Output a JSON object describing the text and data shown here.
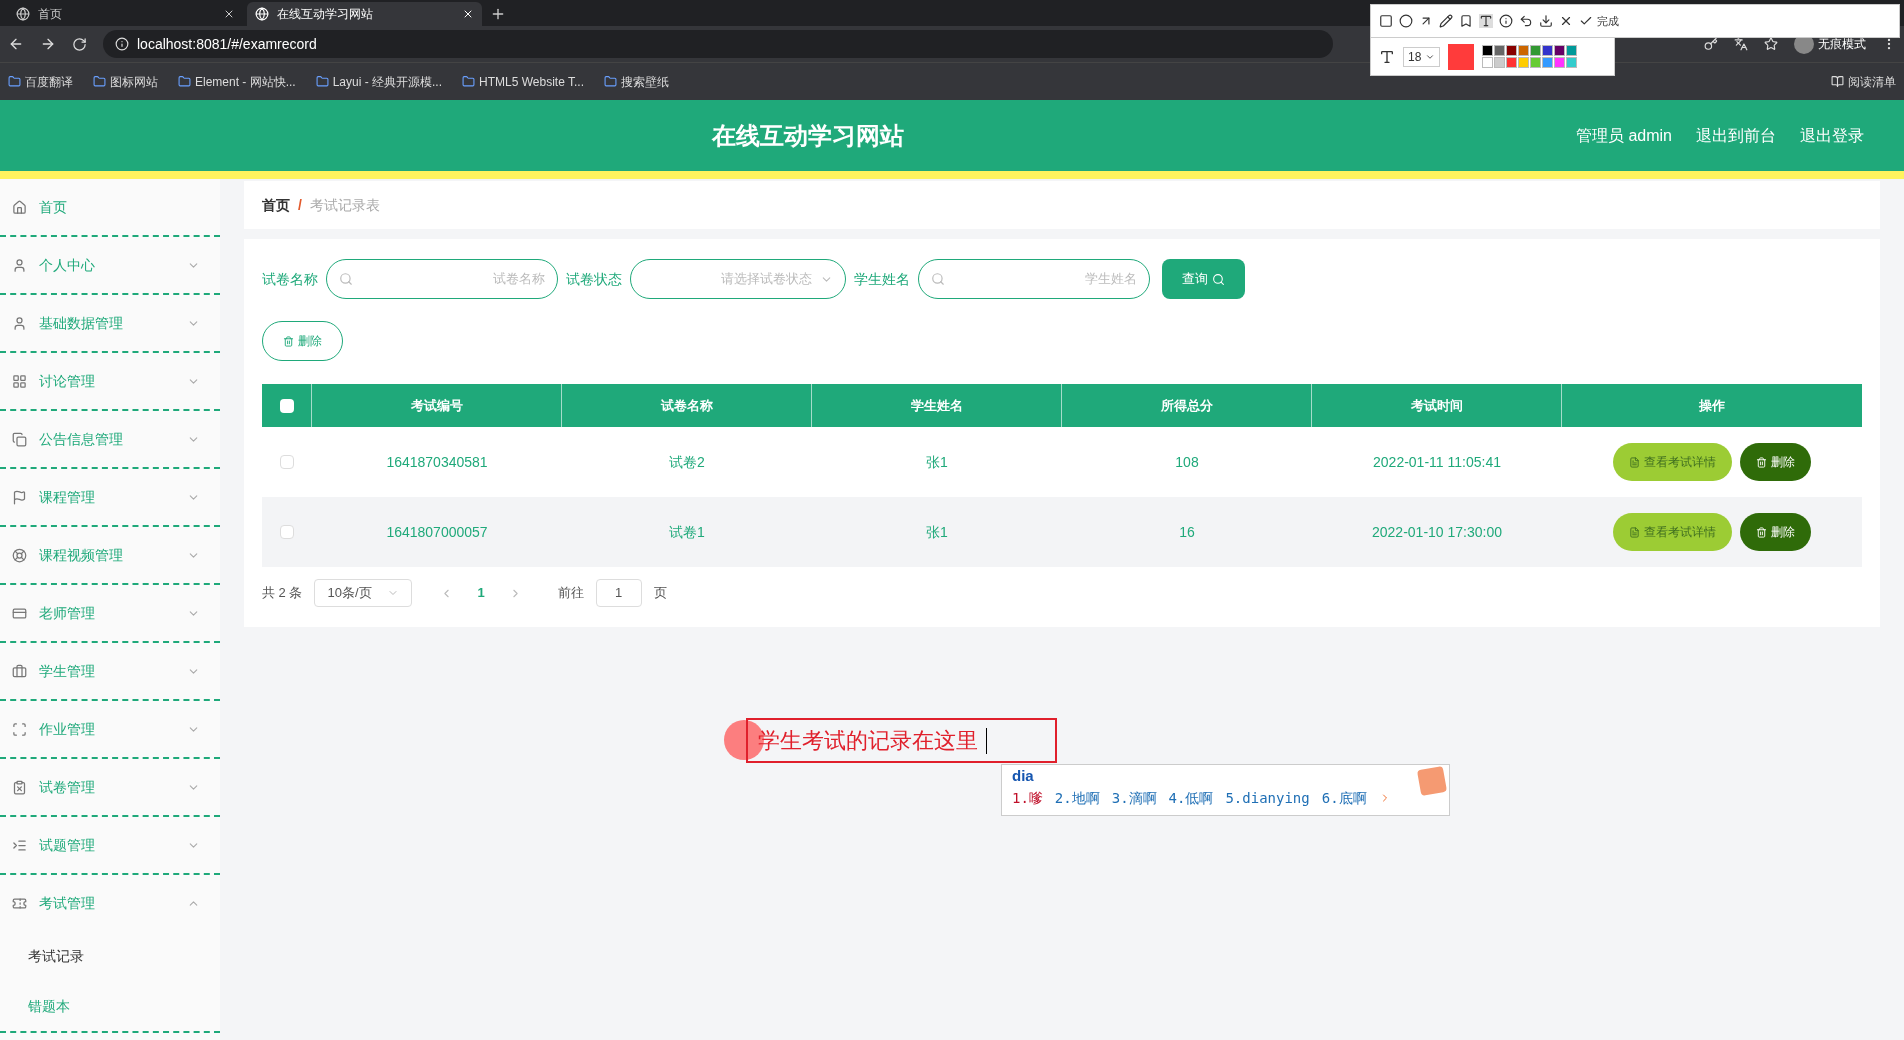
{
  "browser": {
    "tabs": [
      {
        "title": "首页",
        "selected": false
      },
      {
        "title": "在线互动学习网站",
        "selected": true
      }
    ],
    "url": "localhost:8081/#/examrecord",
    "profile": "无痕模式",
    "bookmarks": [
      "百度翻译",
      "图标网站",
      "Element - 网站快...",
      "Layui - 经典开源模...",
      "HTML5 Website T...",
      "搜索壁纸"
    ],
    "reading_list": "阅读清单"
  },
  "annotation_toolbar": {
    "font_size": "18",
    "done": "完成"
  },
  "header": {
    "title": "在线互动学习网站",
    "links": [
      "管理员 admin",
      "退出到前台",
      "退出登录"
    ]
  },
  "sidebar": [
    {
      "label": "首页",
      "kind": "link"
    },
    {
      "label": "个人中心",
      "kind": "group",
      "expanded": false
    },
    {
      "label": "基础数据管理",
      "kind": "group",
      "expanded": false
    },
    {
      "label": "讨论管理",
      "kind": "group",
      "expanded": false
    },
    {
      "label": "公告信息管理",
      "kind": "group",
      "expanded": false
    },
    {
      "label": "课程管理",
      "kind": "group",
      "expanded": false
    },
    {
      "label": "课程视频管理",
      "kind": "group",
      "expanded": false
    },
    {
      "label": "老师管理",
      "kind": "group",
      "expanded": false
    },
    {
      "label": "学生管理",
      "kind": "group",
      "expanded": false
    },
    {
      "label": "作业管理",
      "kind": "group",
      "expanded": false
    },
    {
      "label": "试卷管理",
      "kind": "group",
      "expanded": false
    },
    {
      "label": "试题管理",
      "kind": "group",
      "expanded": false
    },
    {
      "label": "考试管理",
      "kind": "group",
      "expanded": true,
      "children": [
        {
          "label": "考试记录",
          "selected": true
        },
        {
          "label": "错题本",
          "selected": false
        }
      ]
    }
  ],
  "breadcrumb": [
    "首页",
    "/",
    "考试记录表"
  ],
  "filters": [
    {
      "label": "试卷名称",
      "placeholder": "试卷名称",
      "kind": "search"
    },
    {
      "label": "试卷状态",
      "placeholder": "请选择试卷状态",
      "kind": "select"
    },
    {
      "label": "学生姓名",
      "placeholder": "学生姓名",
      "kind": "search"
    }
  ],
  "query_button": "查询",
  "delete_button": "删除",
  "table": {
    "all_checked": false,
    "columns": [
      "考试编号",
      "试卷名称",
      "学生姓名",
      "所得总分",
      "考试时间",
      "操作"
    ],
    "rows": [
      {
        "checked": false,
        "cells": [
          "1641870340581",
          "试卷2",
          "张1",
          "108",
          "2022-01-11 11:05:41"
        ],
        "actions": [
          "查看考试详情",
          "删除"
        ]
      },
      {
        "checked": false,
        "cells": [
          "1641807000057",
          "试卷1",
          "张1",
          "16",
          "2022-01-10 17:30:00"
        ],
        "actions": [
          "查看考试详情",
          "删除"
        ]
      }
    ]
  },
  "pagination": {
    "total": "共 2 条",
    "page_size": "10条/页",
    "current": "1",
    "goto_label": "前往",
    "goto_value": "1",
    "page_unit": "页"
  },
  "annotation": {
    "text": "学生考试的记录在这里",
    "ime": {
      "input": "dia",
      "candidates": [
        {
          "label": "1.嗲",
          "selected": true
        },
        {
          "label": "2.地啊",
          "selected": false
        },
        {
          "label": "3.滴啊",
          "selected": false
        },
        {
          "label": "4.低啊",
          "selected": false
        },
        {
          "label": "5.dianying",
          "selected": false
        },
        {
          "label": "6.底啊",
          "selected": false
        }
      ]
    }
  }
}
